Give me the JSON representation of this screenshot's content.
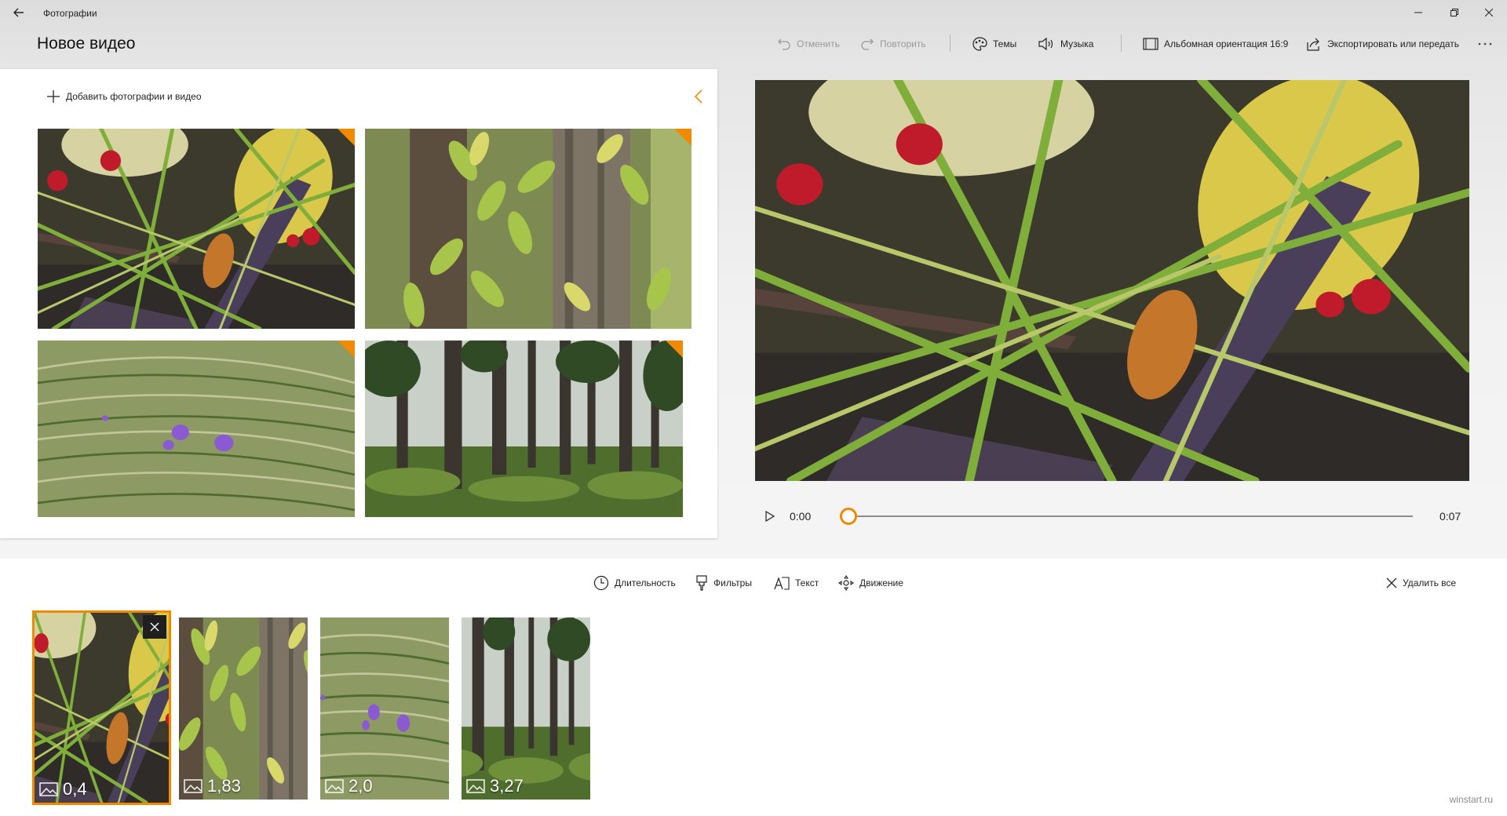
{
  "app": {
    "title": "Фотографии"
  },
  "page": {
    "title": "Новое видео"
  },
  "toolbar": {
    "undo": "Отменить",
    "redo": "Повторить",
    "themes": "Темы",
    "music": "Музыка",
    "aspect": "Альбомная ориентация 16:9",
    "export": "Экспортировать или передать"
  },
  "library": {
    "add_label": "Добавить фотографии и видео"
  },
  "player": {
    "current_time": "0:00",
    "total_time": "0:07",
    "progress": 0.0
  },
  "storyboard_toolbar": {
    "duration": "Длительность",
    "filters": "Фильтры",
    "text": "Текст",
    "motion": "Движение",
    "remove_all": "Удалить все"
  },
  "storyboard": {
    "cards": [
      {
        "duration": "0,4",
        "selected": true
      },
      {
        "duration": "1,83",
        "selected": false
      },
      {
        "duration": "2,0",
        "selected": false
      },
      {
        "duration": "3,27",
        "selected": false
      }
    ]
  },
  "watermark": "winstart.ru",
  "colors": {
    "accent": "#f08a00"
  },
  "icons": {
    "back": "back-arrow-icon",
    "undo": "undo-icon",
    "redo": "redo-icon",
    "themes": "palette-icon",
    "music": "speaker-icon",
    "aspect": "aspect-ratio-icon",
    "export": "share-icon",
    "more": "more-icon",
    "add": "plus-icon",
    "collapse": "chevron-left-icon",
    "play": "play-icon",
    "duration": "clock-icon",
    "filters": "brush-icon",
    "text": "text-icon",
    "motion": "motion-icon",
    "remove_all": "close-icon",
    "photo": "photo-icon"
  }
}
